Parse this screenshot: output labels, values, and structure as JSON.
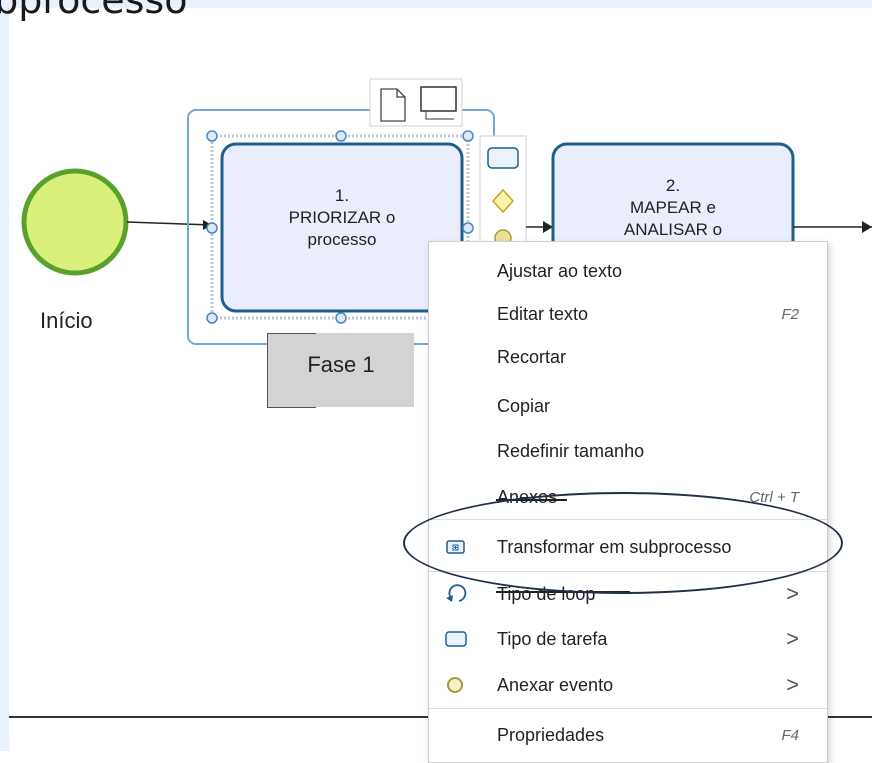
{
  "heading": "ubprocesso",
  "diagram": {
    "start_event_label": "Início",
    "task1": {
      "line1": "1.",
      "line2": "PRIORIZAR o",
      "line3": "processo"
    },
    "task2": {
      "line1": "2.",
      "line2": "MAPEAR e",
      "line3": "ANALISAR o"
    },
    "lane_label": "Fase 1"
  },
  "context_menu": {
    "items": [
      {
        "label": "Ajustar ao texto",
        "shortcut": ""
      },
      {
        "label": "Editar texto",
        "shortcut": "F2"
      },
      {
        "label": "Recortar",
        "shortcut": ""
      },
      {
        "label": "Copiar",
        "shortcut": ""
      },
      {
        "label": "Redefinir tamanho",
        "shortcut": ""
      },
      {
        "label": "Anexos",
        "shortcut": "Ctrl + T"
      },
      {
        "label": "Transformar em subprocesso",
        "shortcut": "",
        "icon": "subprocess-icon"
      },
      {
        "label": "Tipo de loop",
        "shortcut": "",
        "icon": "loop-icon",
        "submenu": true
      },
      {
        "label": "Tipo de tarefa",
        "shortcut": "",
        "icon": "task-type-icon",
        "submenu": true
      },
      {
        "label": "Anexar evento",
        "shortcut": "",
        "icon": "event-icon",
        "submenu": true
      },
      {
        "label": "Propriedades",
        "shortcut": "F4"
      }
    ],
    "submenu_glyph": ">"
  },
  "colors": {
    "start_event_fill": "#d9f07a",
    "start_event_stroke": "#5aa02c",
    "task_fill": "#eaedfb",
    "task_stroke": "#1f5f8f",
    "selection": "#6fa8dc",
    "highlight_ellipse": "#20304a"
  }
}
